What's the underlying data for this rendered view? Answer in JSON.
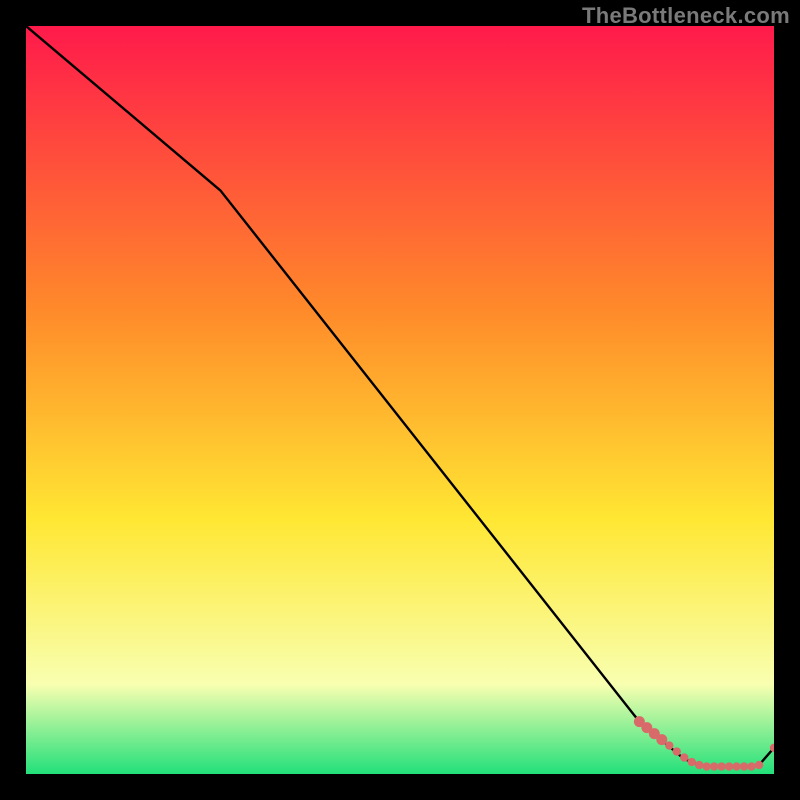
{
  "watermark": "TheBottleneck.com",
  "colors": {
    "background": "#000000",
    "gradient_top": "#ff1a4b",
    "gradient_mid1": "#ff8a2a",
    "gradient_mid2": "#ffe733",
    "gradient_mid3": "#f8ffb0",
    "gradient_bottom": "#22e07a",
    "line": "#000000",
    "marker": "#d86a6a"
  },
  "chart_data": {
    "type": "line",
    "title": "",
    "xlabel": "",
    "ylabel": "",
    "xlim": [
      0,
      100
    ],
    "ylim": [
      0,
      100
    ],
    "grid": false,
    "series": [
      {
        "name": "bottleneck-curve",
        "x": [
          0,
          26,
          82,
          88,
          90,
          92,
          93,
          94,
          95,
          96,
          97,
          98,
          100
        ],
        "y": [
          100,
          78,
          7,
          2,
          1.2,
          1.0,
          1.0,
          1.0,
          1.0,
          1.0,
          1.0,
          1.2,
          3.5
        ]
      }
    ],
    "markers": {
      "name": "highlight-points",
      "x": [
        82,
        83,
        84,
        85,
        86,
        87,
        88,
        89,
        90,
        91,
        92,
        93,
        94,
        95,
        96,
        97,
        98,
        100
      ],
      "y": [
        7,
        6.2,
        5.4,
        4.6,
        3.8,
        3.0,
        2.2,
        1.6,
        1.2,
        1.0,
        1.0,
        1.0,
        1.0,
        1.0,
        1.0,
        1.0,
        1.2,
        3.5
      ]
    }
  }
}
